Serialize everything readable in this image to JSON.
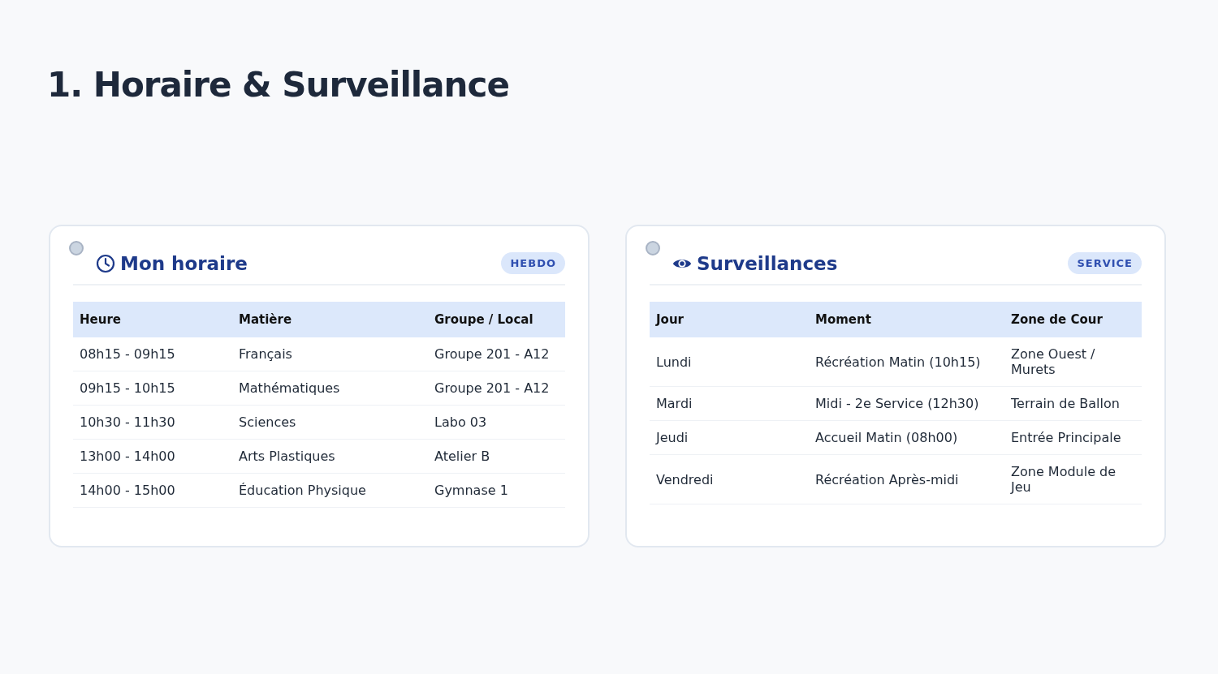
{
  "title": "1. Horaire & Surveillance",
  "cards": [
    {
      "kind": "clock",
      "title": "Mon horaire",
      "badge": "HEBDO",
      "columns": [
        "Heure",
        "Matière",
        "Groupe / Local"
      ],
      "rows": [
        [
          "08h15 - 09h15",
          "Français",
          "Groupe 201 - A12"
        ],
        [
          "09h15 - 10h15",
          "Mathématiques",
          "Groupe 201 - A12"
        ],
        [
          "10h30 - 11h30",
          "Sciences",
          "Labo 03"
        ],
        [
          "13h00 - 14h00",
          "Arts Plastiques",
          "Atelier B"
        ],
        [
          "14h00 - 15h00",
          "Éducation Physique",
          "Gymnase 1"
        ]
      ]
    },
    {
      "kind": "eye",
      "title": "Surveillances",
      "badge": "SERVICE",
      "columns": [
        "Jour",
        "Moment",
        "Zone de Cour"
      ],
      "rows": [
        [
          "Lundi",
          "Récréation Matin (10h15)",
          "Zone Ouest / Murets"
        ],
        [
          "Mardi",
          "Midi - 2e Service (12h30)",
          "Terrain de Ballon"
        ],
        [
          "Jeudi",
          "Accueil Matin (08h00)",
          "Entrée Principale"
        ],
        [
          "Vendredi",
          "Récréation Après-midi",
          "Zone Module de Jeu"
        ]
      ]
    }
  ]
}
